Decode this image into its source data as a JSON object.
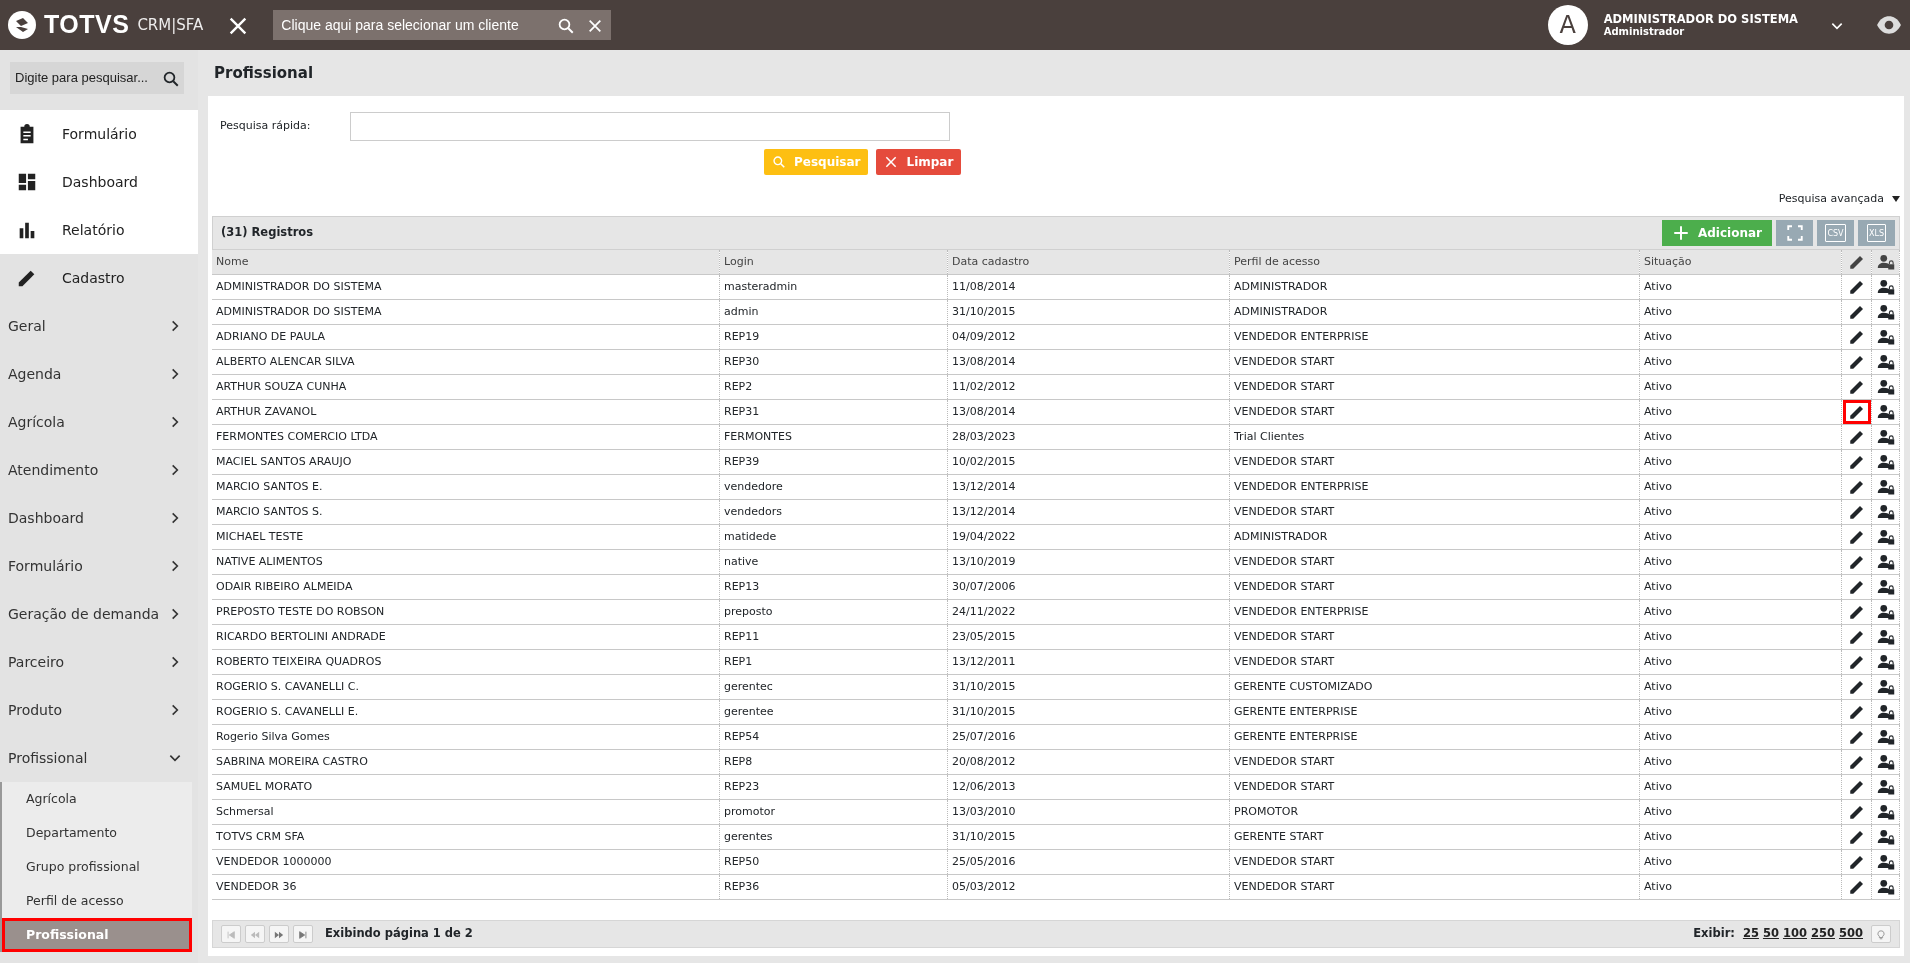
{
  "header": {
    "brand": "TOTVS",
    "product": "CRM|SFA",
    "client_placeholder": "Clique aqui para selecionar um cliente",
    "avatar_letter": "A",
    "user_name": "ADMINISTRADOR DO SISTEMA",
    "user_role": "Administrador"
  },
  "sidebar": {
    "search_placeholder": "Digite para pesquisar...",
    "main_items": [
      {
        "label": "Formulário",
        "kind": "clipboard",
        "selected": false
      },
      {
        "label": "Dashboard",
        "kind": "dashboard",
        "selected": false
      },
      {
        "label": "Relatório",
        "kind": "chart",
        "selected": false
      },
      {
        "label": "Cadastro",
        "kind": "pencil",
        "selected": true
      }
    ],
    "modules": [
      {
        "label": "Geral",
        "expanded": false
      },
      {
        "label": "Agenda",
        "expanded": false
      },
      {
        "label": "Agrícola",
        "expanded": false
      },
      {
        "label": "Atendimento",
        "expanded": false
      },
      {
        "label": "Dashboard",
        "expanded": false
      },
      {
        "label": "Formulário",
        "expanded": false
      },
      {
        "label": "Geração de demanda",
        "expanded": false
      },
      {
        "label": "Parceiro",
        "expanded": false
      },
      {
        "label": "Produto",
        "expanded": false
      },
      {
        "label": "Profissional",
        "expanded": true,
        "children": [
          {
            "label": "Agrícola",
            "selected": false,
            "highlighted": false
          },
          {
            "label": "Departamento",
            "selected": false,
            "highlighted": false
          },
          {
            "label": "Grupo profissional",
            "selected": false,
            "highlighted": false
          },
          {
            "label": "Perfil de acesso",
            "selected": false,
            "highlighted": false
          },
          {
            "label": "Profissional",
            "selected": true,
            "highlighted": true
          }
        ]
      }
    ]
  },
  "page": {
    "title": "Profissional",
    "quick_search_label": "Pesquisa rápida:",
    "search_button": "Pesquisar",
    "clear_button": "Limpar",
    "advanced_search": "Pesquisa avançada"
  },
  "table": {
    "count_label": "(31) Registros",
    "add_button": "Adicionar",
    "csv_label": "CSV",
    "xls_label": "XLS",
    "columns": [
      "Nome",
      "Login",
      "Data cadastro",
      "Perfil de acesso",
      "Situação"
    ],
    "rows": [
      {
        "cells": [
          "ADMINISTRADOR DO SISTEMA",
          "masteradmin",
          "11/08/2014",
          "ADMINISTRADOR",
          "Ativo"
        ],
        "edit_highlighted": false
      },
      {
        "cells": [
          "ADMINISTRADOR DO SISTEMA",
          "admin",
          "31/10/2015",
          "ADMINISTRADOR",
          "Ativo"
        ],
        "edit_highlighted": false
      },
      {
        "cells": [
          "ADRIANO DE PAULA",
          "REP19",
          "04/09/2012",
          "VENDEDOR ENTERPRISE",
          "Ativo"
        ],
        "edit_highlighted": false
      },
      {
        "cells": [
          "ALBERTO ALENCAR SILVA",
          "REP30",
          "13/08/2014",
          "VENDEDOR START",
          "Ativo"
        ],
        "edit_highlighted": false
      },
      {
        "cells": [
          "ARTHUR SOUZA CUNHA",
          "REP2",
          "11/02/2012",
          "VENDEDOR START",
          "Ativo"
        ],
        "edit_highlighted": false
      },
      {
        "cells": [
          "ARTHUR ZAVANOL",
          "REP31",
          "13/08/2014",
          "VENDEDOR START",
          "Ativo"
        ],
        "edit_highlighted": true
      },
      {
        "cells": [
          "FERMONTES COMERCIO LTDA",
          "FERMONTES",
          "28/03/2023",
          "Trial Clientes",
          "Ativo"
        ],
        "edit_highlighted": false
      },
      {
        "cells": [
          "MACIEL SANTOS ARAUJO",
          "REP39",
          "10/02/2015",
          "VENDEDOR START",
          "Ativo"
        ],
        "edit_highlighted": false
      },
      {
        "cells": [
          "MARCIO SANTOS E.",
          "vendedore",
          "13/12/2014",
          "VENDEDOR ENTERPRISE",
          "Ativo"
        ],
        "edit_highlighted": false
      },
      {
        "cells": [
          "MARCIO SANTOS S.",
          "vendedors",
          "13/12/2014",
          "VENDEDOR START",
          "Ativo"
        ],
        "edit_highlighted": false
      },
      {
        "cells": [
          "MICHAEL TESTE",
          "matidede",
          "19/04/2022",
          "ADMINISTRADOR",
          "Ativo"
        ],
        "edit_highlighted": false
      },
      {
        "cells": [
          "NATIVE ALIMENTOS",
          "native",
          "13/10/2019",
          "VENDEDOR START",
          "Ativo"
        ],
        "edit_highlighted": false
      },
      {
        "cells": [
          "ODAIR RIBEIRO ALMEIDA",
          "REP13",
          "30/07/2006",
          "VENDEDOR START",
          "Ativo"
        ],
        "edit_highlighted": false
      },
      {
        "cells": [
          "PREPOSTO TESTE DO ROBSON",
          "preposto",
          "24/11/2022",
          "VENDEDOR ENTERPRISE",
          "Ativo"
        ],
        "edit_highlighted": false
      },
      {
        "cells": [
          "RICARDO BERTOLINI ANDRADE",
          "REP11",
          "23/05/2015",
          "VENDEDOR START",
          "Ativo"
        ],
        "edit_highlighted": false
      },
      {
        "cells": [
          "ROBERTO TEIXEIRA QUADROS",
          "REP1",
          "13/12/2011",
          "VENDEDOR START",
          "Ativo"
        ],
        "edit_highlighted": false
      },
      {
        "cells": [
          "ROGERIO S. CAVANELLI C.",
          "gerentec",
          "31/10/2015",
          "GERENTE CUSTOMIZADO",
          "Ativo"
        ],
        "edit_highlighted": false
      },
      {
        "cells": [
          "ROGERIO S. CAVANELLI E.",
          "gerentee",
          "31/10/2015",
          "GERENTE ENTERPRISE",
          "Ativo"
        ],
        "edit_highlighted": false
      },
      {
        "cells": [
          "Rogerio Silva Gomes",
          "REP54",
          "25/07/2016",
          "GERENTE ENTERPRISE",
          "Ativo"
        ],
        "edit_highlighted": false
      },
      {
        "cells": [
          "SABRINA MOREIRA CASTRO",
          "REP8",
          "20/08/2012",
          "VENDEDOR START",
          "Ativo"
        ],
        "edit_highlighted": false
      },
      {
        "cells": [
          "SAMUEL MORATO",
          "REP23",
          "12/06/2013",
          "VENDEDOR START",
          "Ativo"
        ],
        "edit_highlighted": false
      },
      {
        "cells": [
          "Schmersal",
          "promotor",
          "13/03/2010",
          "PROMOTOR",
          "Ativo"
        ],
        "edit_highlighted": false
      },
      {
        "cells": [
          "TOTVS CRM SFA",
          "gerentes",
          "31/10/2015",
          "GERENTE START",
          "Ativo"
        ],
        "edit_highlighted": false
      },
      {
        "cells": [
          "VENDEDOR 1000000",
          "REP50",
          "25/05/2016",
          "VENDEDOR START",
          "Ativo"
        ],
        "edit_highlighted": false
      },
      {
        "cells": [
          "VENDEDOR 36",
          "REP36",
          "05/03/2012",
          "VENDEDOR START",
          "Ativo"
        ],
        "edit_highlighted": false
      }
    ]
  },
  "pager": {
    "status": "Exibindo página 1 de 2",
    "show_label": "Exibir:",
    "sizes": [
      "25",
      "50",
      "100",
      "250",
      "500"
    ]
  }
}
